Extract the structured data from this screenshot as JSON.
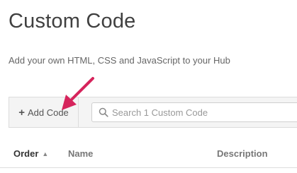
{
  "page": {
    "title": "Custom Code",
    "subtitle": "Add your own HTML, CSS and JavaScript to your Hub"
  },
  "toolbar": {
    "add_label": "Add Code",
    "search_placeholder": "Search 1 Custom Code"
  },
  "table": {
    "columns": [
      {
        "label": "Order",
        "sort": "ascending"
      },
      {
        "label": "Name"
      },
      {
        "label": "Description"
      }
    ]
  },
  "annotation": {
    "arrow_color": "#d6245c"
  }
}
